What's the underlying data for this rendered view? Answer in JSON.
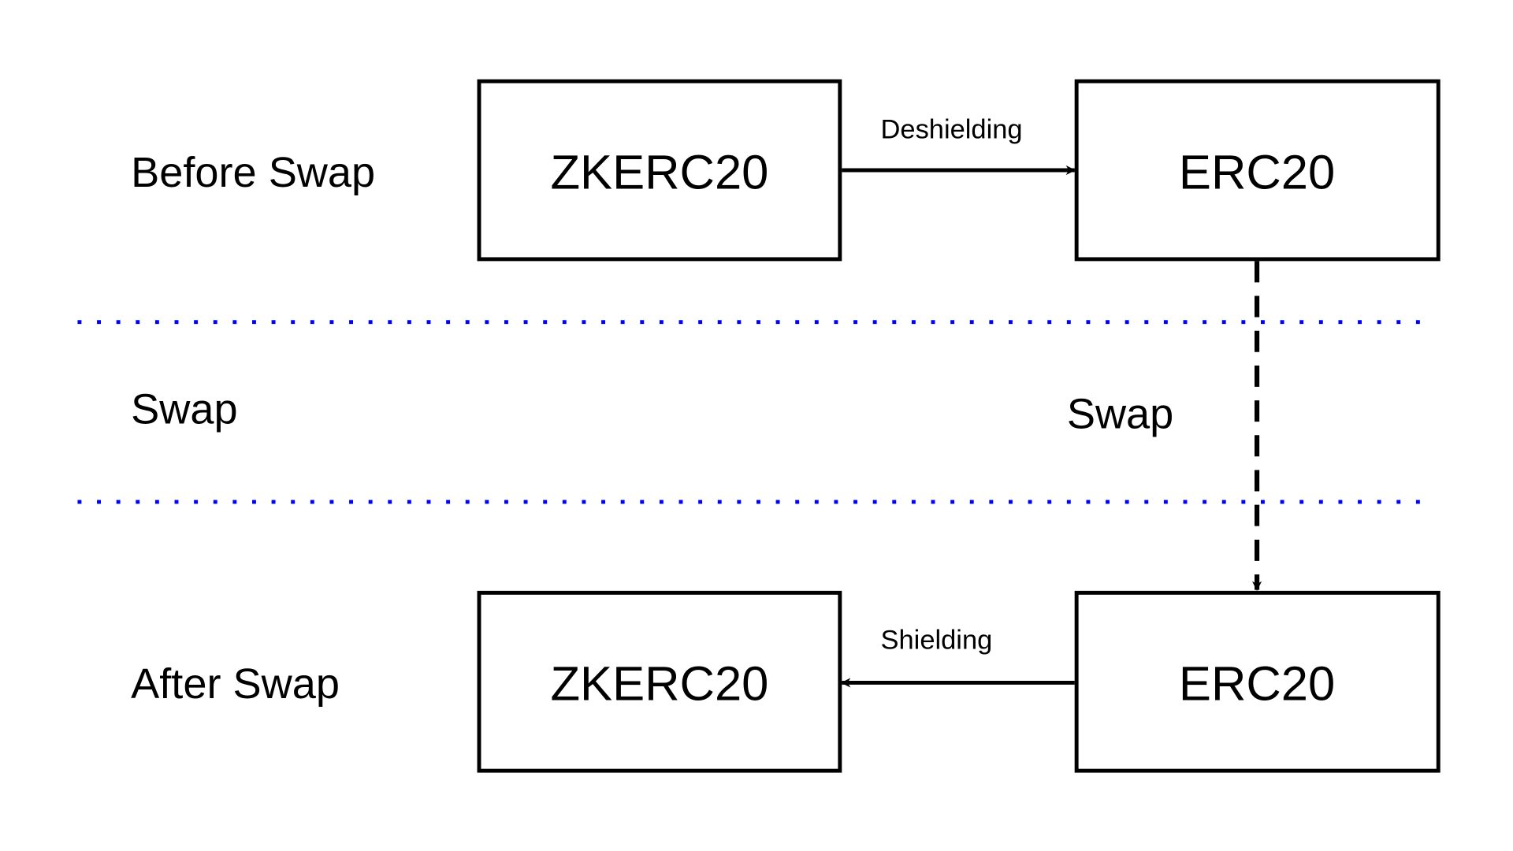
{
  "rows": {
    "before": "Before Swap",
    "swap": "Swap",
    "after": "After Swap"
  },
  "boxes": {
    "before_zk": "ZKERC20",
    "before_erc": "ERC20",
    "after_zk": "ZKERC20",
    "after_erc": "ERC20"
  },
  "edges": {
    "deshielding": "Deshielding",
    "swap": "Swap",
    "shielding": "Shielding"
  },
  "colors": {
    "separator": "#0000ff",
    "stroke": "#000000"
  }
}
